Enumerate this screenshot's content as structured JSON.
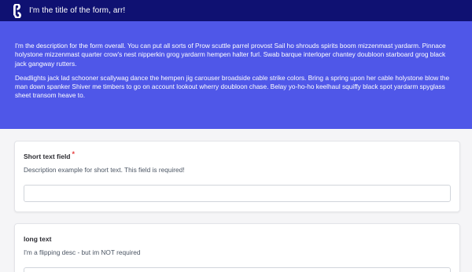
{
  "header": {
    "title": "I'm the title of the form, arr!",
    "logo_icon": "typeform-logo-icon"
  },
  "hero": {
    "paragraphs": [
      "I'm the description for the form overall. You can put all sorts of Prow scuttle parrel provost Sail ho shrouds spirits boom mizzenmast yardarm. Pinnace holystone mizzenmast quarter crow's nest nipperkin grog yardarm hempen halter furl. Swab barque interloper chantey doubloon starboard grog black jack gangway rutters.",
      "Deadlights jack lad schooner scallywag dance the hempen jig carouser broadside cable strike colors. Bring a spring upon her cable holystone blow the man down spanker Shiver me timbers to go on account lookout wherry doubloon chase. Belay yo-ho-ho keelhaul squiffy black spot yardarm spyglass sheet transom heave to."
    ],
    "background": "#4f57e8"
  },
  "fields": [
    {
      "label": "Short text field",
      "required_marker": "*",
      "description": "Description example for short text. This field is required!",
      "value": "",
      "placeholder": ""
    },
    {
      "label": "long text",
      "description": "I'm a flipping desc - but im NOT required",
      "value": "",
      "placeholder": ""
    }
  ],
  "colors": {
    "topbar": "#0f1172",
    "accent": "#4f57e8",
    "required": "#e53e3e"
  }
}
